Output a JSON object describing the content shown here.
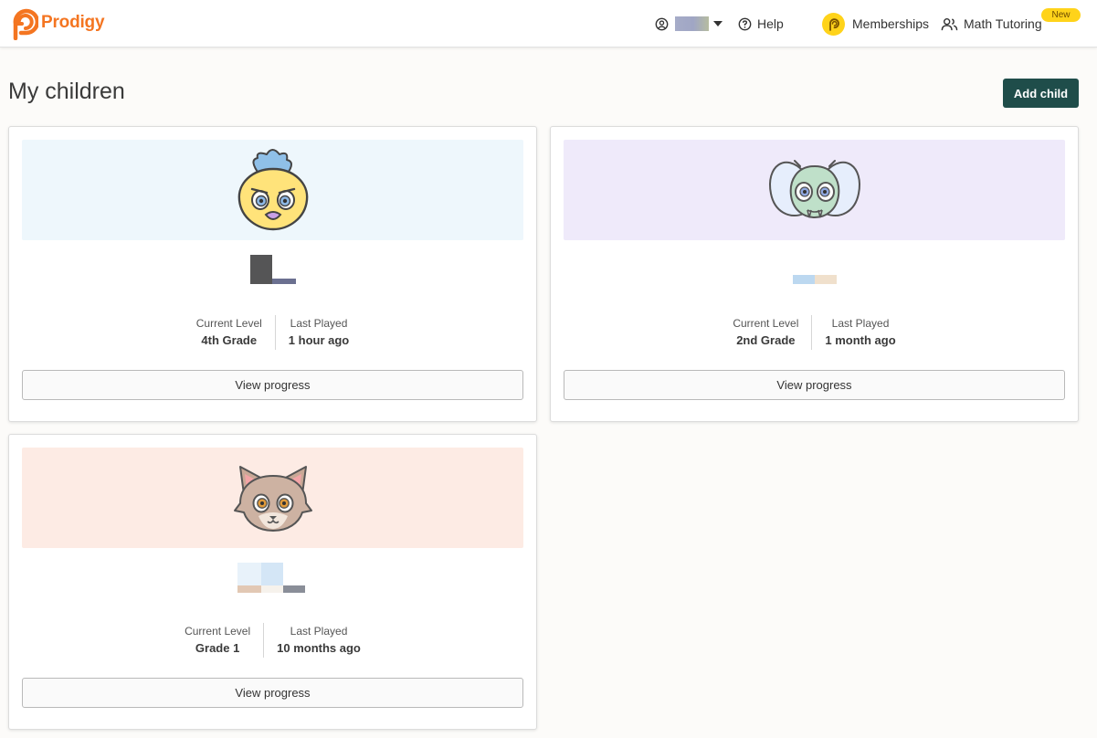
{
  "header": {
    "brand": "Prodigy",
    "brand_color": "#f47521",
    "nav": {
      "help": "Help",
      "memberships": "Memberships",
      "math_tutoring": "Math Tutoring",
      "new_badge": "New"
    }
  },
  "page": {
    "title": "My children",
    "add_child_label": "Add child",
    "accent_color": "#1f4d4a"
  },
  "children": [
    {
      "avatar": "bird-avatar",
      "banner_color": "#eef7fc",
      "level_label": "Current Level",
      "level_value": "4th Grade",
      "played_label": "Last Played",
      "played_value": "1 hour ago",
      "button_label": "View progress"
    },
    {
      "avatar": "bug-avatar",
      "banner_color": "#efeafa",
      "level_label": "Current Level",
      "level_value": "2nd Grade",
      "played_label": "Last Played",
      "played_value": "1 month ago",
      "button_label": "View progress"
    },
    {
      "avatar": "cat-avatar",
      "banner_color": "#fdebe4",
      "level_label": "Current Level",
      "level_value": "Grade 1",
      "played_label": "Last Played",
      "played_value": "10 months ago",
      "button_label": "View progress"
    }
  ]
}
